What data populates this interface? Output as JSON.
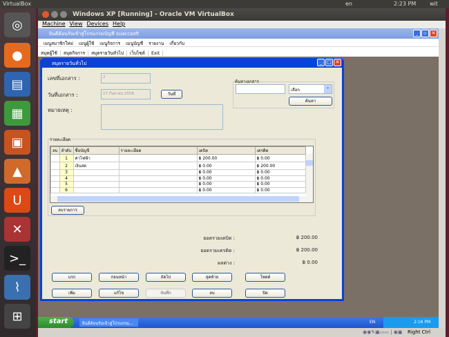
{
  "ubuntu": {
    "app_name": "VirtualBox",
    "lang": "en",
    "time": "2:23 PM",
    "user": "wit"
  },
  "vbox": {
    "title": "Windows XP [Running] - Oracle VM VirtualBox",
    "menu": [
      "Machine",
      "View",
      "Devices",
      "Help"
    ],
    "host_key": "Right Ctrl"
  },
  "app": {
    "title": "ยินดีต้อนรับเข้าสู่โปรแกรมบัญชี suaccsoft",
    "menu": [
      "เมนูสมาชิกใหม่",
      "เมนูผู้ใช้",
      "เมนูกิจการ",
      "เมนูบัญชี",
      "รายงาน",
      "เกี่ยวกับ"
    ],
    "toolbar": [
      "สมุดผู้ใช้",
      "สมุดกิจการ",
      "สมุดรายวันทั่วไป",
      "เว็บไซต์",
      "Exit"
    ]
  },
  "journal": {
    "title": "สมุดรายวันทั่วไป",
    "doc_no_label": "เลขที่เอกสาร :",
    "doc_no": "2",
    "doc_date_label": "วันที่เอกสาร :",
    "doc_date": "17 กันยายน 2558",
    "date_button": "วันที่",
    "note_label": "หมายเหตุ :",
    "search": {
      "group_label": "ค้นหาเอกสาร",
      "select_value": "เลือก",
      "button": "ค้นหา"
    },
    "detail_label": "รายละเอียด",
    "columns": [
      "ลบ",
      "ลำดับ",
      "ชื่อบัญชี",
      "รายละเอียด",
      "เดบิต",
      "เครดิต"
    ],
    "rows": [
      [
        "",
        "1",
        "ค่าไฟฟ้า",
        "",
        "฿ 200.00",
        "฿ 0.00"
      ],
      [
        "",
        "2",
        "เงินสด",
        "",
        "฿ 0.00",
        "฿ 200.00"
      ],
      [
        "",
        "3",
        "",
        "",
        "฿ 0.00",
        "฿ 0.00"
      ],
      [
        "",
        "4",
        "",
        "",
        "฿ 0.00",
        "฿ 0.00"
      ],
      [
        "",
        "5",
        "",
        "",
        "฿ 0.00",
        "฿ 0.00"
      ],
      [
        "",
        "6",
        "",
        "",
        "฿ 0.00",
        "฿ 0.00"
      ]
    ],
    "delete_row_button": "ลบรายการ",
    "total_debit_label": "ยอดรวมเดบิต :",
    "total_debit": "฿ 200.00",
    "total_credit_label": "ยอดรวมเครดิต :",
    "total_credit": "฿ 200.00",
    "diff_label": "ผลต่าง :",
    "diff": "฿ 0.00",
    "buttons_row1": [
      "แรก",
      "ก่อนหน้า",
      "ถัดไป",
      "สุดท้าย",
      "โพสต์"
    ],
    "buttons_row2": [
      "เพิ่ม",
      "แก้ไข",
      "บันทึก",
      "ลบ",
      "ปิด"
    ]
  },
  "xp": {
    "start": "start",
    "task": "ยินดีต้อนรับเข้าสู่โปรแกรม...",
    "lang": "EN",
    "time": "2:16 PM"
  }
}
